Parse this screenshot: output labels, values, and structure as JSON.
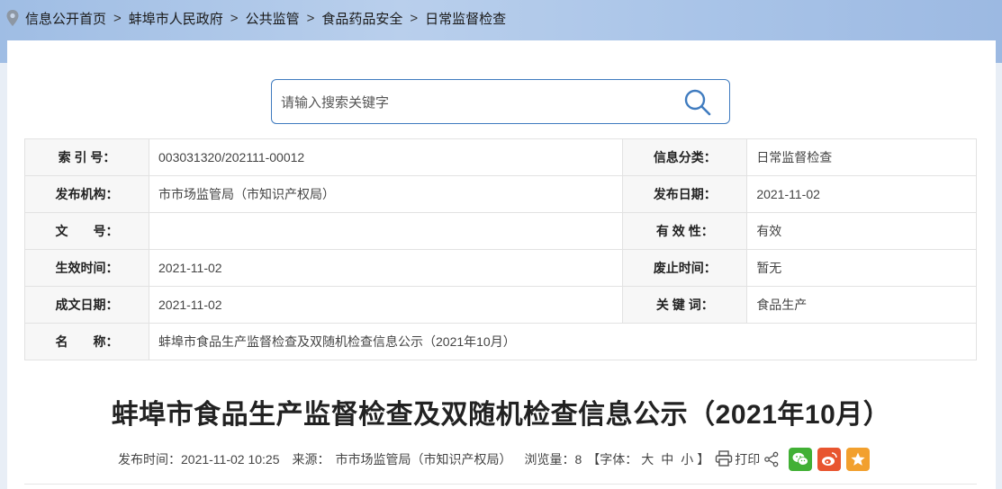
{
  "breadcrumb": {
    "items": [
      "信息公开首页",
      "蚌埠市人民政府",
      "公共监管",
      "食品药品安全",
      "日常监督检查"
    ],
    "separator": ">"
  },
  "search": {
    "placeholder": "请输入搜索关键字",
    "value": ""
  },
  "meta": {
    "rows": [
      {
        "l1": "索 引 号：",
        "v1": "003031320/202111-00012",
        "l2": "信息分类：",
        "v2": "日常监督检查"
      },
      {
        "l1": "发布机构：",
        "v1": "市市场监管局（市知识产权局）",
        "l2": "发布日期：",
        "v2": "2021-11-02"
      },
      {
        "l1": "文　　号：",
        "v1": "",
        "l2": "有 效 性：",
        "v2": "有效"
      },
      {
        "l1": "生效时间：",
        "v1": "2021-11-02",
        "l2": "废止时间：",
        "v2": "暂无"
      },
      {
        "l1": "成文日期：",
        "v1": "2021-11-02",
        "l2": "关 键 词：",
        "v2": "食品生产"
      }
    ],
    "name_label": "名　　称：",
    "name_value": "蚌埠市食品生产监督检查及双随机检查信息公示（2021年10月）"
  },
  "article": {
    "title": "蚌埠市食品生产监督检查及双随机检查信息公示（2021年10月）",
    "publish_label": "发布时间：",
    "publish_time": "2021-11-02 10:25",
    "source_label": "来源：",
    "source": "市市场监管局（市知识产权局）",
    "views_label": "浏览量：",
    "views": "8",
    "font_open": "【字体：",
    "font_large": "大",
    "font_medium": "中",
    "font_small": "小",
    "font_close": "】",
    "print_label": "打印"
  },
  "icons": {
    "location": "location-pin-icon",
    "search": "search-icon",
    "print": "printer-icon",
    "share": "share-icon",
    "wechat": "wechat-icon",
    "weibo": "weibo-icon",
    "favorite": "star-icon"
  },
  "colors": {
    "accent": "#3f7bbf",
    "wechat": "#41b035",
    "weibo": "#e8552f",
    "favorite": "#f2a02e"
  }
}
